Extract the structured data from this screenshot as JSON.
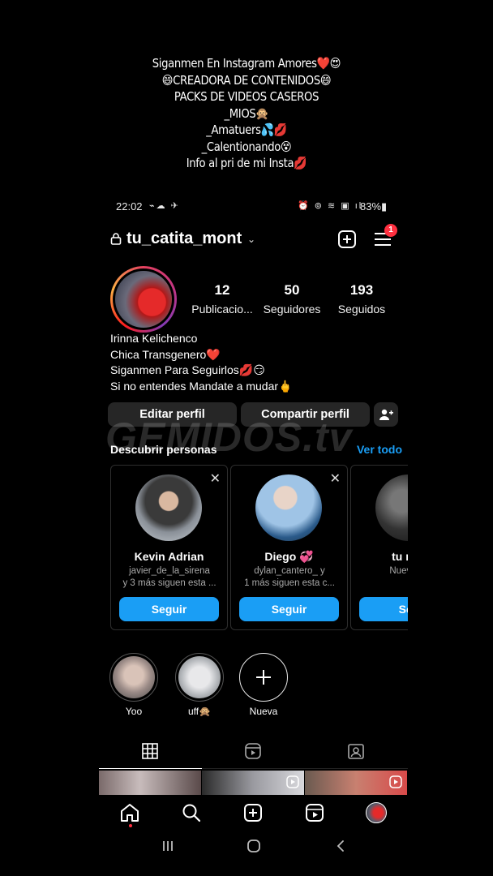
{
  "caption": {
    "lines": [
      "Siganmen En Instagram Amores❤️😍",
      "😄CREADORA DE CONTENIDOS😄",
      "PACKS DE VIDEOS CASEROS",
      "_MIOS🙊",
      "_Amatuers💦💋",
      "_Calentionando😵",
      "Info al pri de mi Insta💋"
    ]
  },
  "statusbar": {
    "time": "22:02",
    "left_icons": "⌁☁ ✈",
    "right_icons": "⏰ ⊚ ≋ ▣ ıl",
    "battery": "83%▮"
  },
  "header": {
    "username": "tu_catita_mont",
    "chevron": "⌄",
    "menu_badge": "1"
  },
  "profile": {
    "stats": [
      {
        "value": "12",
        "label": "Publicacio..."
      },
      {
        "value": "50",
        "label": "Seguidores"
      },
      {
        "value": "193",
        "label": "Seguidos"
      }
    ],
    "bio": {
      "name": "Irinna Kelichenco",
      "line1": "Chica Transgenero❤️",
      "line2": "Siganmen Para Seguirlos💋😏",
      "line3": "Si no entendes Mandate a mudar🖕"
    },
    "buttons": {
      "edit": "Editar perfil",
      "share": "Compartir perfil"
    }
  },
  "watermark": "GEMIDOS.tv",
  "discover": {
    "title": "Descubrir personas",
    "see_all": "Ver todo",
    "cards": [
      {
        "name": "Kevin Adrian",
        "handle": "javier_de_la_sirena",
        "mutual": "y 3 más siguen esta ...",
        "button": "Seguir",
        "close": "✕"
      },
      {
        "name": "Diego 💞",
        "handle": "dylan_cantero_ y",
        "mutual": "1 más siguen esta c...",
        "button": "Seguir",
        "close": "✕"
      },
      {
        "name": "tu mer",
        "handle": "Nuevo en",
        "mutual": "",
        "button": "Seg",
        "close": ""
      }
    ]
  },
  "highlights": [
    {
      "label": "Yoo"
    },
    {
      "label": "uff🙊"
    },
    {
      "label": "Nueva"
    }
  ],
  "colors": {
    "accent": "#1a9ef5",
    "badge": "#ff3040",
    "button_bg": "#262626"
  }
}
